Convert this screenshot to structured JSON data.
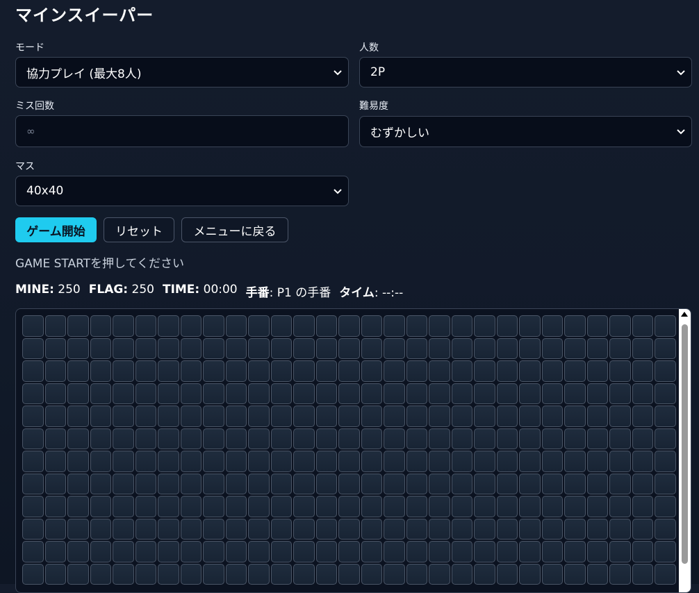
{
  "title": "マインスイーパー",
  "mode": {
    "label": "モード",
    "value": "協力プレイ (最大8人)"
  },
  "players": {
    "label": "人数",
    "value": "2P"
  },
  "misses": {
    "label": "ミス回数",
    "placeholder": "∞"
  },
  "difficulty": {
    "label": "難易度",
    "value": "むずかしい"
  },
  "grid_size": {
    "label": "マス",
    "value": "40x40"
  },
  "buttons": {
    "start": "ゲーム開始",
    "reset": "リセット",
    "menu": "メニューに戻る"
  },
  "status": "GAME STARTを押してください",
  "stats": {
    "mine_label": "MINE:",
    "mine_value": "250",
    "flag_label": "FLAG:",
    "flag_value": "250",
    "time_label": "TIME:",
    "time_value": "00:00",
    "turn_label": "手番",
    "turn_value": ": P1 の手番",
    "timer_label": "タイム",
    "timer_value": ": --:--"
  },
  "colors": {
    "accent": "#1fcbef",
    "background": "#111a29",
    "cell": "#1c2839",
    "cell_border": "#4a5566"
  }
}
